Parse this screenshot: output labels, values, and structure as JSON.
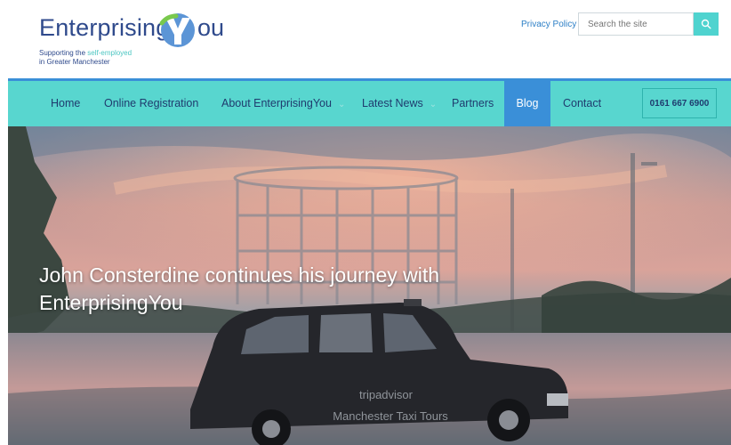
{
  "brand": {
    "logo_word": "Enterprising",
    "logo_ou": "ou",
    "tagline_1_prefix": "Supporting the ",
    "tagline_1_highlight": "self-employed",
    "tagline_2": "in Greater Manchester"
  },
  "header": {
    "privacy_label": "Privacy Policy",
    "search_placeholder": "Search the site",
    "search_icon": "search-icon"
  },
  "nav": {
    "items": [
      {
        "label": "Home"
      },
      {
        "label": "Online Registration"
      },
      {
        "label": "About EnterprisingYou",
        "has_dropdown": true
      },
      {
        "label": "Latest News",
        "has_dropdown": true
      },
      {
        "label": "Partners"
      },
      {
        "label": "Blog",
        "active": true
      },
      {
        "label": "Contact"
      }
    ],
    "phone": "0161 667 6900"
  },
  "hero": {
    "title": "John Consterdine continues his journey with EnterprisingYou",
    "taxi_sign_line1": "tripadvisor",
    "taxi_sign_line2": "Manchester Taxi Tours"
  },
  "colors": {
    "brand_navy": "#2f4a8c",
    "nav_teal": "#58d6cf",
    "active_blue": "#3a8fd8",
    "link_blue": "#2c7fc6"
  }
}
